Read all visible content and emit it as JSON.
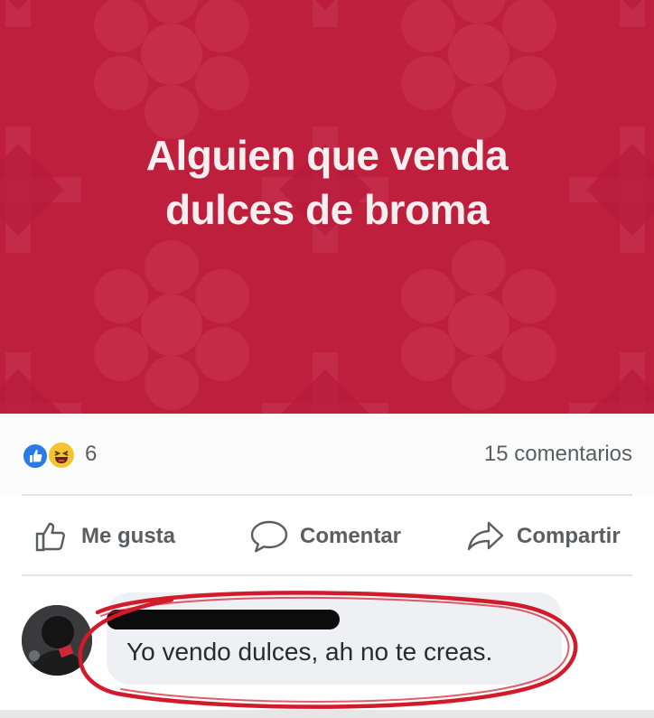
{
  "post": {
    "line1": "Alguien que venda",
    "line2": "dulces de broma",
    "background_color": "#bd1f3c"
  },
  "reactions": {
    "types": [
      "like-icon",
      "haha-icon"
    ],
    "count": "6",
    "comments": "15 comentarios"
  },
  "actions": {
    "like": "Me gusta",
    "comment": "Comentar",
    "share": "Compartir"
  },
  "comment": {
    "author_redacted": true,
    "text": "Yo vendo dulces, ah no te creas.",
    "highlight_color": "#d11a2a"
  }
}
